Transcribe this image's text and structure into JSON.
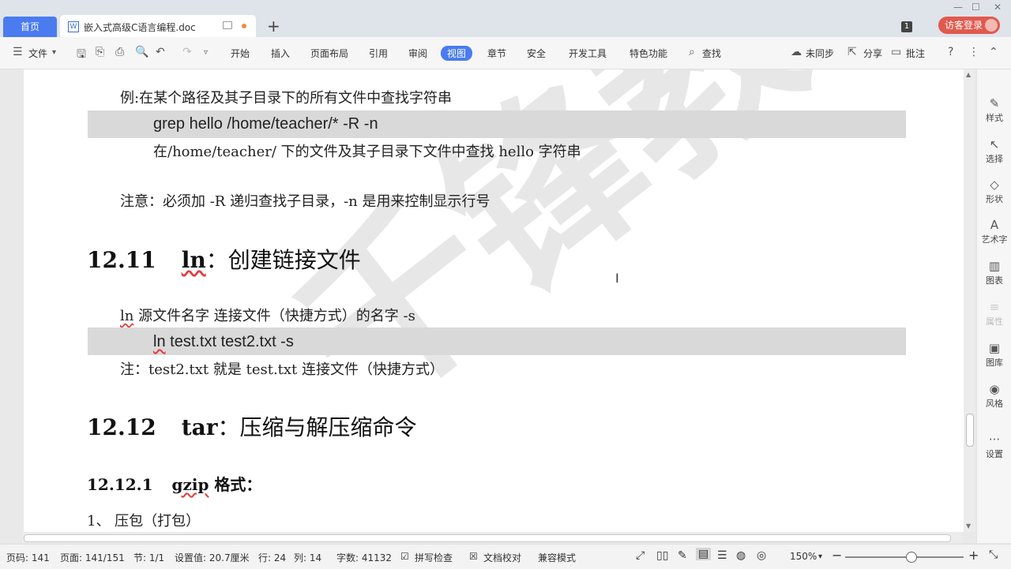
{
  "tabs": {
    "home": "首页",
    "doc_title": "嵌入式高级C语言编程.doc",
    "new_tab": "+"
  },
  "window": {
    "page_count_badge": "1",
    "login": "访客登录"
  },
  "ribbon": {
    "file": "文件",
    "tabs": [
      "开始",
      "插入",
      "页面布局",
      "引用",
      "审阅",
      "视图",
      "章节",
      "安全",
      "开发工具",
      "特色功能"
    ],
    "active_tab": "视图",
    "search": "查找",
    "sync": "未同步",
    "share": "分享",
    "comment": "批注"
  },
  "document": {
    "p1": "例:在某个路径及其子目录下的所有文件中查找字符串",
    "code1": "grep    hello    /home/teacher/*    -R -n",
    "p2": "在/home/teacher/    下的文件及其子目录下文件中查找 hello 字符串",
    "p3": "注意：必须加  -R  递归查找子目录，-n 是用来控制显示行号",
    "h_1211_num": "12.11",
    "h_1211_cmd": "ln",
    "h_1211_text": "：创建链接文件",
    "p4_cmd": "ln",
    "p4_rest": " 源文件名字      连接文件（快捷方式）的名字  -s",
    "code2_cmd": "ln",
    "code2_rest": "    test.txt    test2.txt        -s",
    "p5": "注：test2.txt  就是 test.txt  连接文件（快捷方式）",
    "h_1212_num": "12.12",
    "h_1212_cmd": "tar",
    "h_1212_text": "：压缩与解压缩命令",
    "h_12121_num": "12.12.1",
    "h_12121_cmd": "gzip",
    "h_12121_text": " 格式：",
    "p6": "1、  压包（打包）",
    "watermark": "千锋教"
  },
  "right_panel": [
    "样式",
    "选择",
    "形状",
    "艺术字",
    "图表",
    "属性",
    "图库",
    "风格",
    "设置"
  ],
  "status": {
    "page": "页码: 141",
    "pages": "页面: 141/151",
    "section": "节: 1/1",
    "setting": "设置值: 20.7厘米",
    "row": "行: 24",
    "col": "列: 14",
    "words": "字数: 41132",
    "spell": "拼写检查",
    "proof": "文档校对",
    "compat": "兼容模式",
    "zoom": "150%",
    "zoom_level": 0.55
  }
}
